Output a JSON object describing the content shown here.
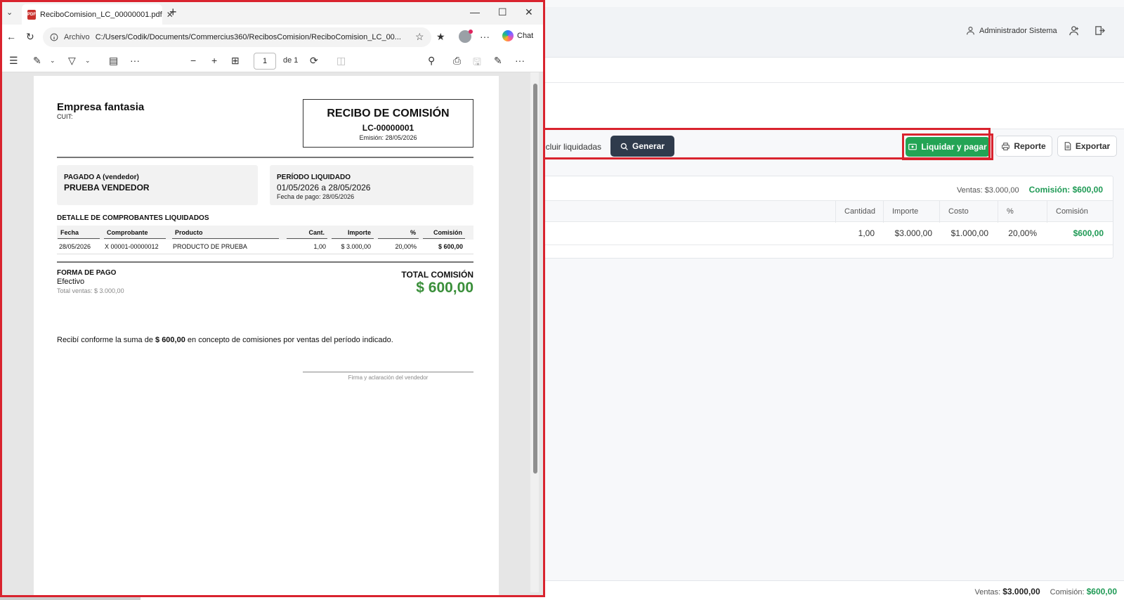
{
  "app": {
    "user_name": "Administrador Sistema",
    "incluir_label": "ncluir liquidadas",
    "generar_label": "Generar",
    "liquidar_label": "Liquidar y pagar",
    "reporte_label": "Reporte",
    "exportar_label": "Exportar",
    "summary": {
      "ventas_label": "Ventas: $3.000,00",
      "comision_label": "Comisión: $600,00"
    },
    "grid": {
      "headers": [
        "Cantidad",
        "Importe",
        "Costo",
        "%",
        "Comisión"
      ],
      "row": [
        "1,00",
        "$3.000,00",
        "$1.000,00",
        "20,00%",
        "$600,00"
      ]
    },
    "footer": {
      "ventas_label": "Ventas:",
      "ventas_value": "$3.000,00",
      "comision_label": "Comisión:",
      "comision_value": "$600,00"
    }
  },
  "pdf_window": {
    "tab_title": "ReciboComision_LC_00000001.pdf",
    "address_label": "Archivo",
    "address": "C:/Users/Codik/Documents/Commercius360/RecibosComision/ReciboComision_LC_00...",
    "chat_label": "Chat",
    "page_current": "1",
    "page_of": "de 1"
  },
  "receipt": {
    "company": "Empresa fantasia",
    "cuit": "CUIT:",
    "title": "RECIBO DE COMISIÓN",
    "number": "LC-00000001",
    "emision": "Emisión: 28/05/2026",
    "pagado_header": "PAGADO A (vendedor)",
    "vendedor": "PRUEBA VENDEDOR",
    "periodo_header": "PERÍODO LIQUIDADO",
    "periodo": "01/05/2026 a 28/05/2026",
    "fecha_pago": "Fecha de pago: 28/05/2026",
    "detalle_title": "DETALLE DE COMPROBANTES LIQUIDADOS",
    "table": {
      "headers": [
        "Fecha",
        "Comprobante",
        "Producto",
        "Cant.",
        "Importe",
        "%",
        "Comisión"
      ],
      "row": [
        "28/05/2026",
        "X 00001-00000012",
        "PRODUCTO DE PRUEBA",
        "1,00",
        "$ 3.000,00",
        "20,00%",
        "$ 600,00"
      ]
    },
    "forma_pago_header": "FORMA DE PAGO",
    "forma_pago": "Efectivo",
    "total_ventas": "Total ventas: $ 3.000,00",
    "total_comision_header": "TOTAL COMISIÓN",
    "total_comision": "$ 600,00",
    "recibi_pre": "Recibí conforme la suma de ",
    "recibi_amount": "$ 600,00",
    "recibi_post": " en concepto de comisiones por ventas del período indicado.",
    "firma": "Firma y aclaración del vendedor"
  },
  "colors": {
    "highlight": "#d9232e",
    "green": "#23a455",
    "dark_button": "#2f3b4c",
    "total_green": "#3a8f3a"
  },
  "icons": [
    "user-icon",
    "user-add-icon",
    "logout-icon",
    "search-icon",
    "money-icon",
    "printer-icon",
    "file-icon",
    "pdf-icon",
    "back-icon",
    "refresh-icon",
    "star-icon",
    "favorites-icon",
    "more-icon",
    "copilot-icon",
    "list-icon",
    "draw-icon",
    "highlighter-icon",
    "text-icon",
    "zoom-out-icon",
    "zoom-in-icon",
    "fit-icon",
    "rotate-icon",
    "save-icon",
    "print-icon",
    "save-as-icon",
    "chevron-down-icon",
    "close-icon"
  ]
}
